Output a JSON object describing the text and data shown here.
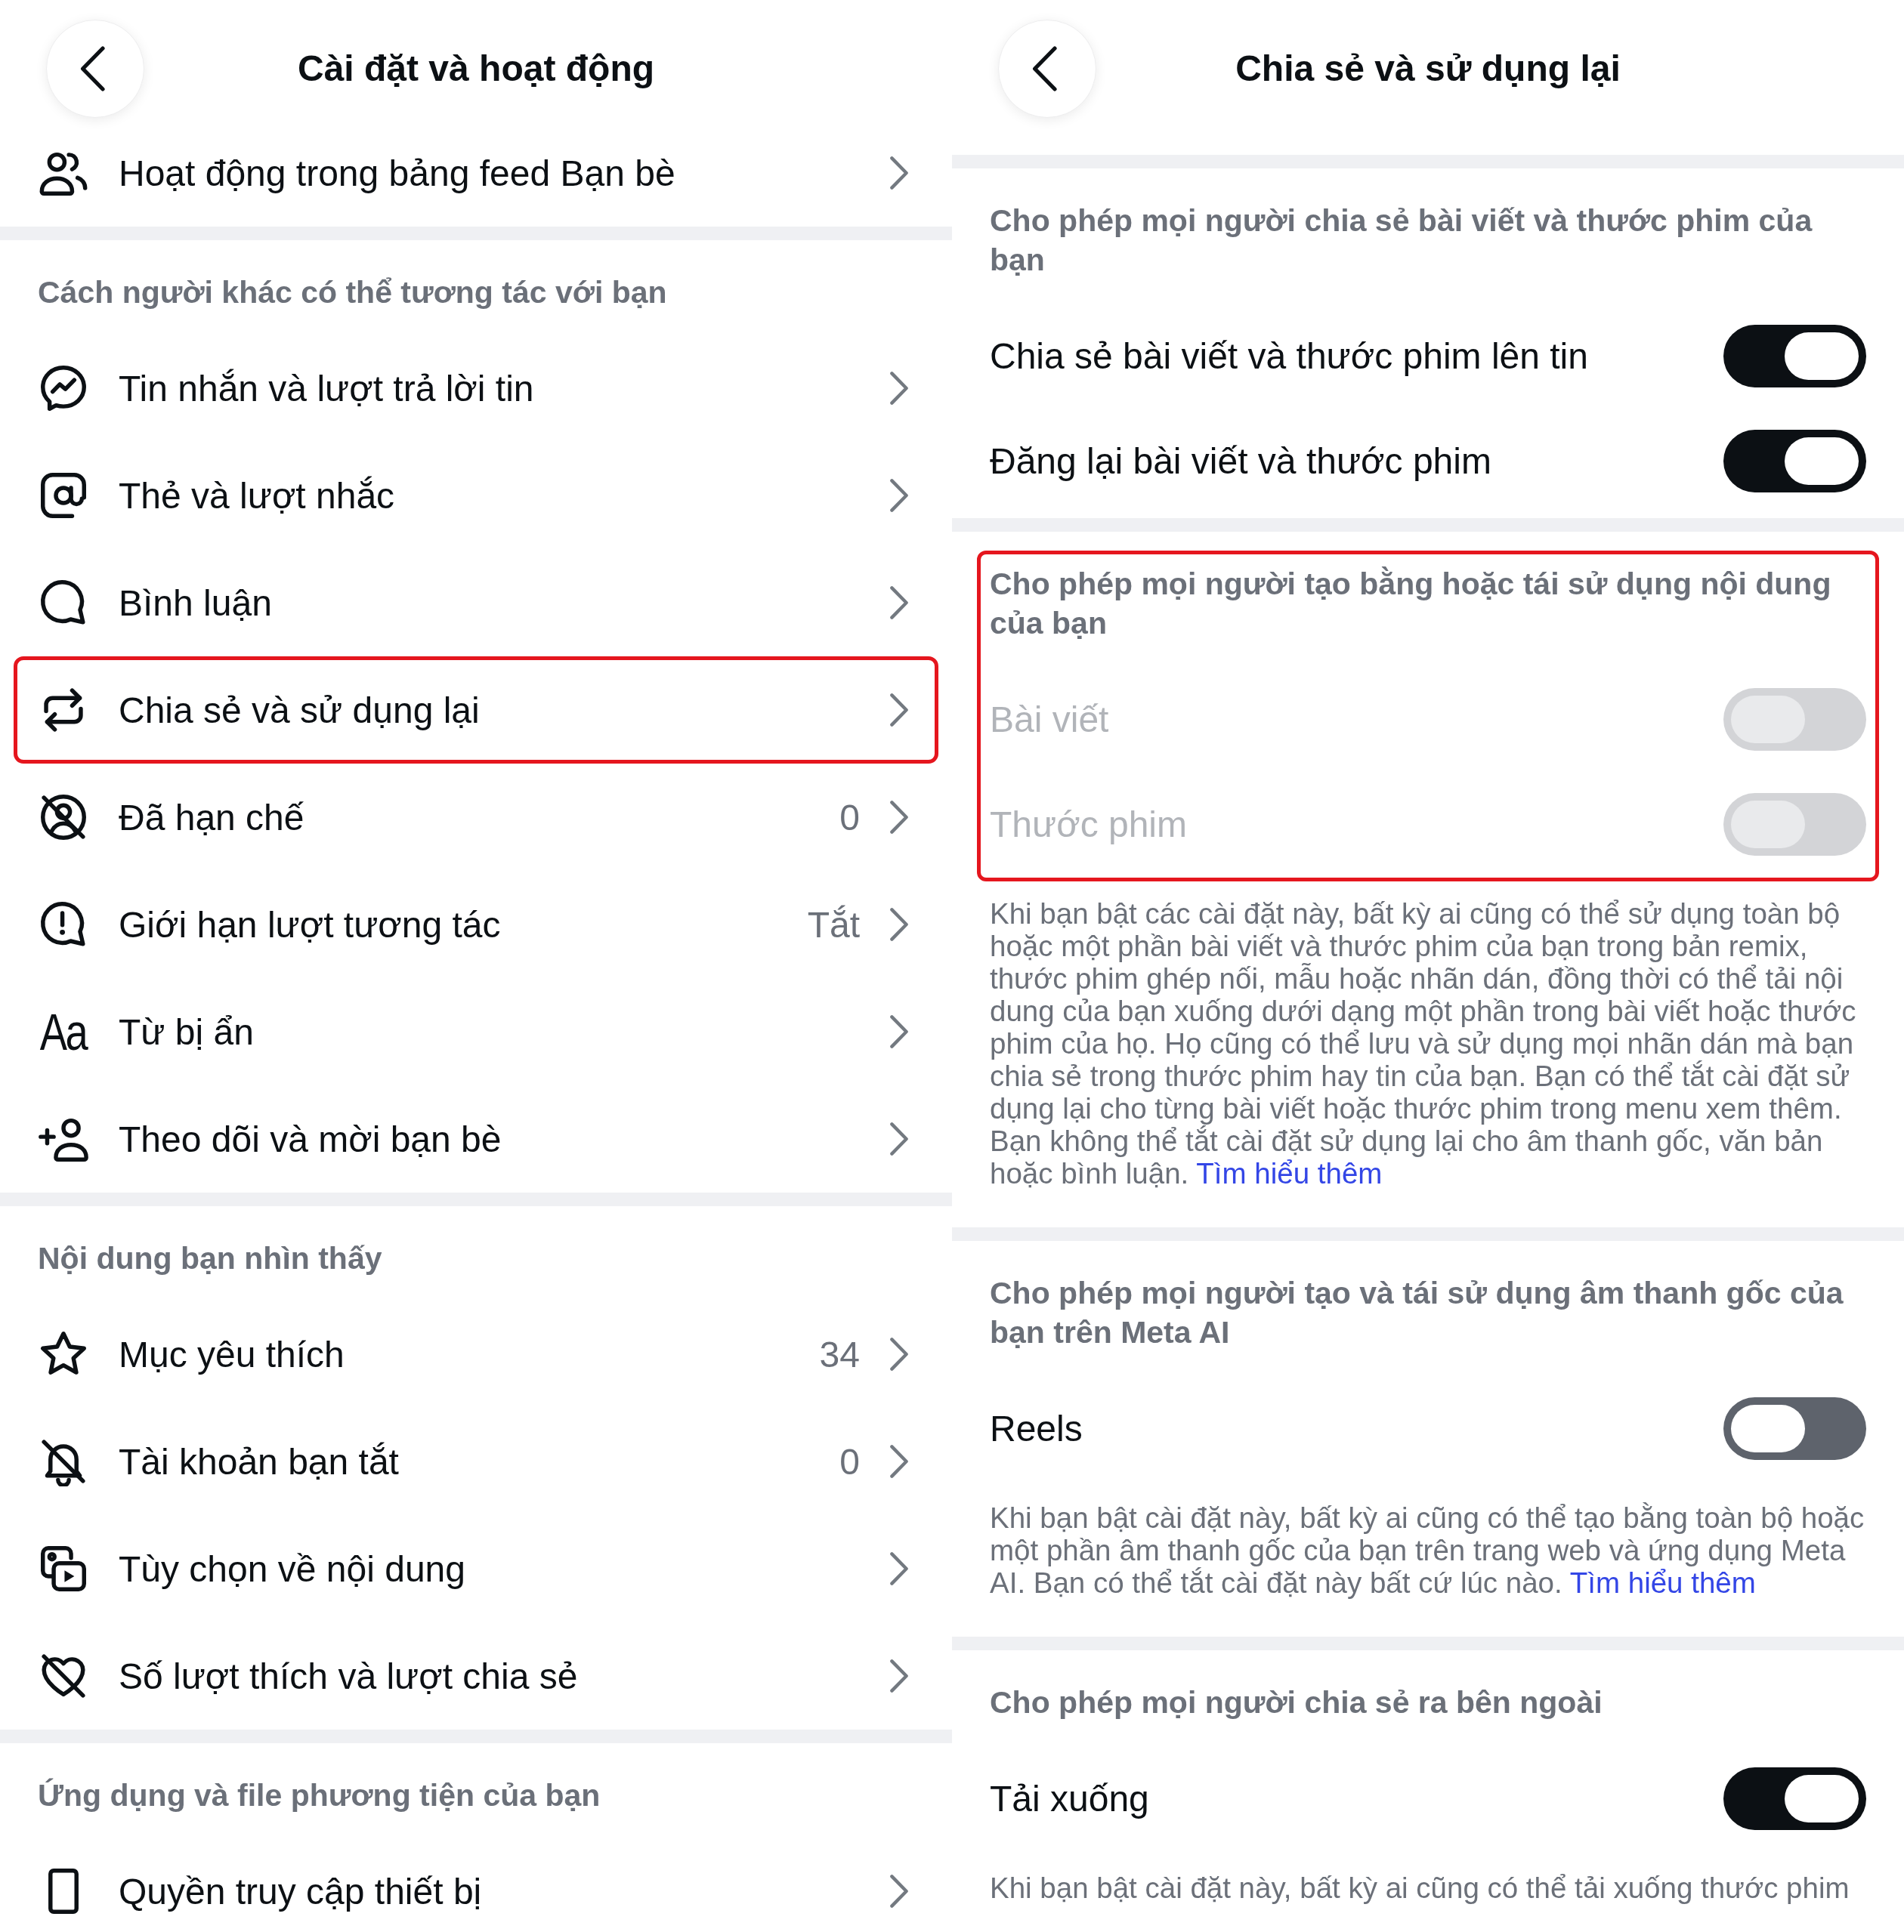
{
  "left_panel": {
    "header": {
      "title": "Cài đặt và hoạt động"
    },
    "sections": [
      {
        "items": [
          {
            "label": "Hoạt động trong bảng feed Bạn bè",
            "highlighted": false
          }
        ]
      },
      {
        "title": "Cách người khác có thể tương tác với bạn",
        "items": [
          {
            "label": "Tin nhắn và lượt trả lời tin",
            "highlighted": false
          },
          {
            "label": "Thẻ và lượt nhắc",
            "highlighted": false
          },
          {
            "label": "Bình luận",
            "highlighted": false
          },
          {
            "label": "Chia sẻ và sử dụng lại",
            "highlighted": true
          },
          {
            "label": "Đã hạn chế",
            "value": "0",
            "highlighted": false
          },
          {
            "label": "Giới hạn lượt tương tác",
            "value": "Tắt",
            "highlighted": false
          },
          {
            "label": "Từ bị ẩn",
            "icon_text": "Aa",
            "highlighted": false
          },
          {
            "label": "Theo dõi và mời bạn bè",
            "highlighted": false
          }
        ]
      },
      {
        "title": "Nội dung bạn nhìn thấy",
        "items": [
          {
            "label": "Mục yêu thích",
            "value": "34",
            "highlighted": false
          },
          {
            "label": "Tài khoản bạn tắt",
            "value": "0",
            "highlighted": false
          },
          {
            "label": "Tùy chọn về nội dung",
            "highlighted": false
          },
          {
            "label": "Số lượt thích và lượt chia sẻ",
            "highlighted": false
          }
        ]
      },
      {
        "title": "Ứng dụng và file phương tiện của bạn",
        "items": [
          {
            "label": "Quyền truy cập thiết bị",
            "highlighted": false
          }
        ]
      }
    ]
  },
  "right_panel": {
    "header": {
      "title": "Chia sẻ và sử dụng lại"
    },
    "sections": [
      {
        "title": "Cho phép mọi người chia sẻ bài viết và thước phim của bạn",
        "highlighted": false,
        "settings": [
          {
            "label": "Chia sẻ bài viết và thước phim lên tin",
            "on": true,
            "disabled": false
          },
          {
            "label": "Đăng lại bài viết và thước phim",
            "on": true,
            "disabled": false
          }
        ]
      },
      {
        "title": "Cho phép mọi người tạo bằng hoặc tái sử dụng nội dung của bạn",
        "highlighted": true,
        "settings": [
          {
            "label": "Bài viết",
            "on": false,
            "disabled": true
          },
          {
            "label": "Thước phim",
            "on": false,
            "disabled": true
          }
        ],
        "description": {
          "text": "Khi bạn bật các cài đặt này, bất kỳ ai cũng có thể sử dụng toàn bộ hoặc một phần bài viết và thước phim của bạn trong bản remix, thước phim ghép nối, mẫu hoặc nhãn dán, đồng thời có thể tải nội dung của bạn xuống dưới dạng một phần trong bài viết hoặc thước phim của họ. Họ cũng có thể lưu và sử dụng mọi nhãn dán mà bạn chia sẻ trong thước phim hay tin của bạn. Bạn có thể tắt cài đặt sử dụng lại cho từng bài viết hoặc thước phim trong menu xem thêm. Bạn không thể tắt cài đặt sử dụng lại cho âm thanh gốc, văn bản hoặc bình luận.",
          "link": "Tìm hiểu thêm"
        }
      },
      {
        "title": "Cho phép mọi người tạo và tái sử dụng âm thanh gốc của bạn trên Meta AI",
        "highlighted": false,
        "settings": [
          {
            "label": "Reels",
            "on": false,
            "disabled": false
          }
        ],
        "description": {
          "text": "Khi bạn bật cài đặt này, bất kỳ ai cũng có thể tạo bằng toàn bộ hoặc một phần âm thanh gốc của bạn trên trang web và ứng dụng Meta AI. Bạn có thể tắt cài đặt này bất cứ lúc nào.",
          "link": "Tìm hiểu thêm"
        }
      },
      {
        "title": "Cho phép mọi người chia sẻ ra bên ngoài",
        "highlighted": false,
        "settings": [
          {
            "label": "Tải xuống",
            "on": true,
            "disabled": false
          }
        ],
        "description": {
          "text": "Khi bạn bật cài đặt này, bất kỳ ai cũng có thể tải xuống thước phim"
        }
      }
    ]
  }
}
